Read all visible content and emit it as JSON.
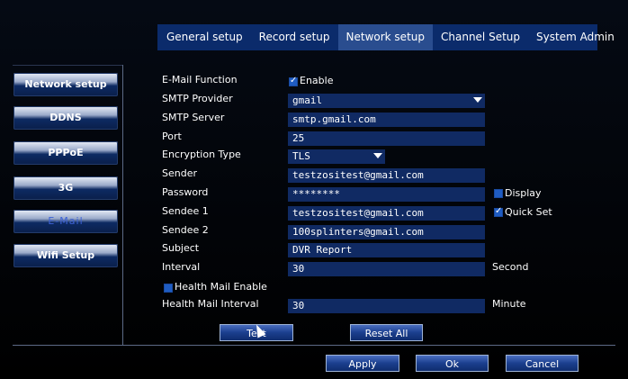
{
  "tabs": [
    {
      "label": "General setup"
    },
    {
      "label": "Record setup"
    },
    {
      "label": "Network setup"
    },
    {
      "label": "Channel Setup"
    },
    {
      "label": "System Admin"
    }
  ],
  "sidebar": [
    {
      "label": "Network setup"
    },
    {
      "label": "DDNS"
    },
    {
      "label": "PPPoE"
    },
    {
      "label": "3G"
    },
    {
      "label": "E-Mail"
    },
    {
      "label": "Wifi Setup"
    }
  ],
  "form": {
    "email_function": {
      "label": "E-Mail Function",
      "checkbox_label": "Enable",
      "checked": true
    },
    "smtp_provider": {
      "label": "SMTP Provider",
      "value": "gmail"
    },
    "smtp_server": {
      "label": "SMTP Server",
      "value": "smtp.gmail.com"
    },
    "port": {
      "label": "Port",
      "value": "25"
    },
    "encryption_type": {
      "label": "Encryption Type",
      "value": "TLS"
    },
    "sender": {
      "label": "Sender",
      "value": "testzositest@gmail.com"
    },
    "password": {
      "label": "Password",
      "value": "********",
      "display_label": "Display",
      "display_checked": false
    },
    "sendee1": {
      "label": "Sendee 1",
      "value": "testzositest@gmail.com",
      "quickset_label": "Quick Set",
      "quickset_checked": true
    },
    "sendee2": {
      "label": "Sendee 2",
      "value": "100splinters@gmail.com"
    },
    "subject": {
      "label": "Subject",
      "value": "DVR Report"
    },
    "interval": {
      "label": "Interval",
      "value": "30",
      "unit": "Second"
    },
    "health_mail": {
      "label": "Health Mail Enable",
      "checked": false
    },
    "health_interval": {
      "label": "Health Mail Interval",
      "value": "30",
      "unit": "Minute"
    }
  },
  "buttons": {
    "test": "Test",
    "reset_all": "Reset All",
    "apply": "Apply",
    "ok": "Ok",
    "cancel": "Cancel"
  },
  "colors": {
    "tab_bar": "#0b2b6b",
    "active_tab": "#2a4d8f",
    "field_bg": "#102a63",
    "active_side_text": "#3d62d6"
  }
}
